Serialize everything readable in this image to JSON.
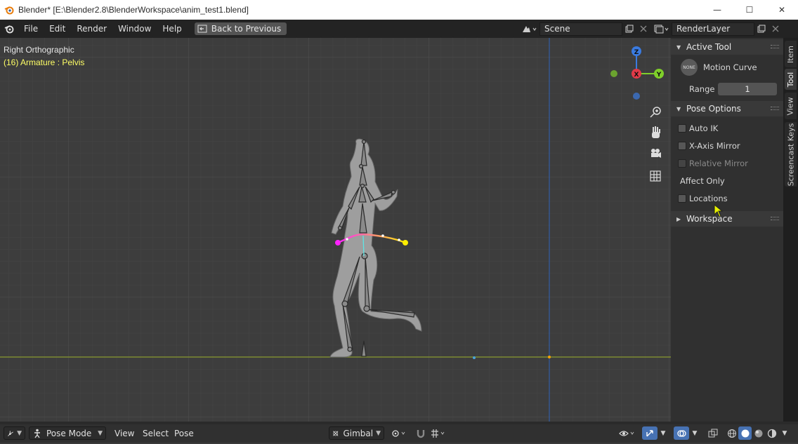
{
  "window": {
    "title": "Blender* [E:\\Blender2.8\\BlenderWorkspace\\anim_test1.blend]",
    "minimize": "—",
    "maximize": "☐",
    "close": "✕"
  },
  "menubar": {
    "items": [
      "File",
      "Edit",
      "Render",
      "Window",
      "Help"
    ],
    "back_label": "Back to Previous",
    "scene_value": "Scene",
    "render_layer_value": "RenderLayer"
  },
  "viewport": {
    "view_name": "Right Orthographic",
    "object_info": "(16) Armature : Pelvis",
    "object_info_color": "#ffff66",
    "gizmo": {
      "z": "Z",
      "x": "X",
      "y": "Y"
    },
    "colors": {
      "x_axis": "#e23a48",
      "y_axis": "#7fcf2a",
      "z_axis": "#3a7be0",
      "ground_line": "#8a9a30",
      "vertical_axis": "#2f63b8",
      "curve_start": "#ff22ff",
      "curve_end": "#ffee00"
    }
  },
  "npanel": {
    "active_tool": {
      "header": "Active Tool",
      "tool_badge": "NONE",
      "tool_name": "Motion Curve",
      "range_label": "Range",
      "range_value": "1"
    },
    "pose_options": {
      "header": "Pose Options",
      "auto_ik": "Auto IK",
      "x_axis_mirror": "X-Axis Mirror",
      "relative_mirror": "Relative Mirror",
      "affect_only": "Affect Only",
      "locations": "Locations"
    },
    "workspace": {
      "header": "Workspace"
    },
    "tabs": [
      "Item",
      "Tool",
      "View",
      "Screencast Keys"
    ],
    "active_tab": "Tool"
  },
  "bottombar": {
    "mode": "Pose Mode",
    "menus": [
      "View",
      "Select",
      "Pose"
    ],
    "orientation": "Gimbal"
  }
}
